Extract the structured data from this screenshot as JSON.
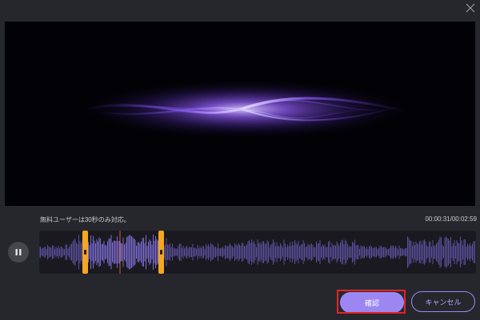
{
  "dialog": {
    "close_icon": "close-icon"
  },
  "editor": {
    "note": "無料ユーザーは30秒のみ対応。",
    "time": "00:00:31/00:02:59",
    "play_state_icon": "pause-icon"
  },
  "buttons": {
    "confirm": "確認",
    "cancel": "キャンセル"
  },
  "colors": {
    "accent": "#9c87f2",
    "handle": "#f5a623",
    "highlight": "#e52424",
    "waveform": "#5a4f9a",
    "waveform_selected": "#7b6ccf"
  }
}
